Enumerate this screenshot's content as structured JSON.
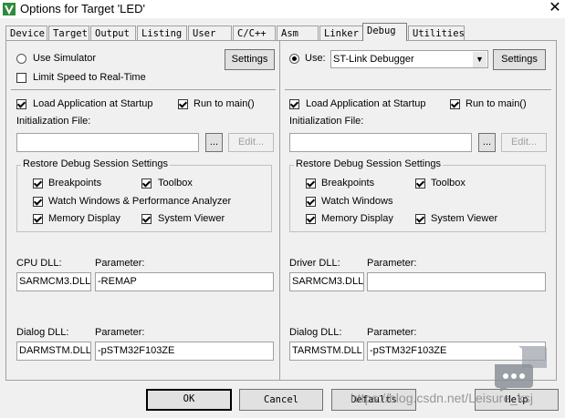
{
  "window": {
    "title": "Options for Target 'LED'",
    "close_glyph": "✕"
  },
  "tabs": [
    {
      "label": "Device"
    },
    {
      "label": "Target"
    },
    {
      "label": "Output"
    },
    {
      "label": "Listing"
    },
    {
      "label": "User"
    },
    {
      "label": "C/C++"
    },
    {
      "label": "Asm"
    },
    {
      "label": "Linker"
    },
    {
      "label": "Debug",
      "active": true
    },
    {
      "label": "Utilities"
    }
  ],
  "left": {
    "use_simulator": "Use Simulator",
    "limit_speed": "Limit Speed to Real-Time",
    "settings": "Settings",
    "load_app": "Load Application at Startup",
    "run_to_main": "Run to main()",
    "init_file_label": "Initialization File:",
    "init_file_value": "",
    "browse": "...",
    "edit": "Edit...",
    "restore_title": "Restore Debug Session Settings",
    "breakpoints": "Breakpoints",
    "toolbox": "Toolbox",
    "watch": "Watch Windows & Performance Analyzer",
    "memory": "Memory Display",
    "sysviewer": "System Viewer",
    "cpu_dll_label": "CPU DLL:",
    "cpu_param_label": "Parameter:",
    "cpu_dll": "SARMCM3.DLL",
    "cpu_param": "-REMAP",
    "dialog_dll_label": "Dialog DLL:",
    "dialog_param_label": "Parameter:",
    "dialog_dll": "DARMSTM.DLL",
    "dialog_param": "-pSTM32F103ZE"
  },
  "right": {
    "use": "Use:",
    "debugger": "ST-Link Debugger",
    "settings": "Settings",
    "load_app": "Load Application at Startup",
    "run_to_main": "Run to main()",
    "init_file_label": "Initialization File:",
    "init_file_value": "",
    "browse": "...",
    "edit": "Edit...",
    "restore_title": "Restore Debug Session Settings",
    "breakpoints": "Breakpoints",
    "toolbox": "Toolbox",
    "watch": "Watch Windows",
    "memory": "Memory Display",
    "sysviewer": "System Viewer",
    "driver_dll_label": "Driver DLL:",
    "driver_param_label": "Parameter:",
    "driver_dll": "SARMCM3.DLL",
    "driver_param": "",
    "dialog_dll_label": "Dialog DLL:",
    "dialog_param_label": "Parameter:",
    "dialog_dll": "TARMSTM.DLL",
    "dialog_param": "-pSTM32F103ZE"
  },
  "footer": {
    "ok": "OK",
    "cancel": "Cancel",
    "defaults": "Defaults",
    "help": "Help"
  },
  "watermark": "https://blog.csdn.net/Leisure_ksj",
  "colors": {
    "accent": "#0078d7",
    "app_icon": "#2e8b3a"
  }
}
